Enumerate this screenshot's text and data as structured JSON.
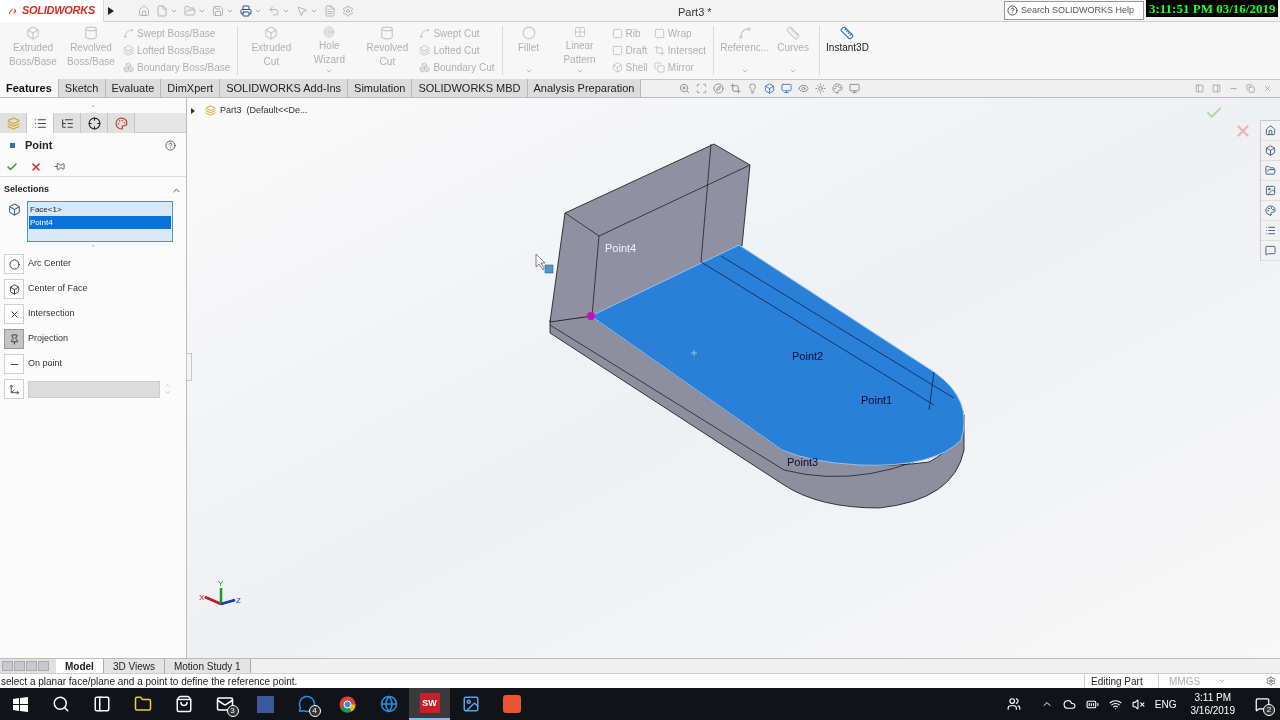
{
  "title_bar": {
    "logo": "SOLIDWORKS",
    "title": "Part3 *",
    "search": {
      "placeholder": "Search SOLIDWORKS Help"
    },
    "recording_timestamp": "3:11:51 PM 03/16/2019"
  },
  "ribbon": [
    {
      "kind": "large",
      "label": "Extruded Boss/Base",
      "disabled": true,
      "dropdown": false
    },
    {
      "kind": "large",
      "label": "Revolved Boss/Base",
      "disabled": true,
      "dropdown": false
    },
    {
      "kind": "stack",
      "items": [
        {
          "label": "Swept Boss/Base",
          "disabled": true
        },
        {
          "label": "Lofted Boss/Base",
          "disabled": true
        },
        {
          "label": "Boundary Boss/Base",
          "disabled": true
        }
      ]
    },
    {
      "kind": "separator"
    },
    {
      "kind": "large",
      "label": "Extruded Cut",
      "disabled": true,
      "dropdown": false
    },
    {
      "kind": "large",
      "label": "Hole Wizard",
      "disabled": true,
      "dropdown": true
    },
    {
      "kind": "large",
      "label": "Revolved Cut",
      "disabled": true,
      "dropdown": false
    },
    {
      "kind": "stack",
      "items": [
        {
          "label": "Swept Cut",
          "disabled": true
        },
        {
          "label": "Lofted Cut",
          "disabled": true
        },
        {
          "label": "Boundary Cut",
          "disabled": true
        }
      ]
    },
    {
      "kind": "separator"
    },
    {
      "kind": "large",
      "label": "Fillet",
      "disabled": true,
      "dropdown": true
    },
    {
      "kind": "large",
      "label": "Linear Pattern",
      "disabled": true,
      "dropdown": true
    },
    {
      "kind": "stack",
      "items": [
        {
          "label": "Rib",
          "disabled": true
        },
        {
          "label": "Draft",
          "disabled": true
        },
        {
          "label": "Shell",
          "disabled": true
        }
      ]
    },
    {
      "kind": "stack",
      "items": [
        {
          "label": "Wrap",
          "disabled": true
        },
        {
          "label": "Intersect",
          "disabled": true
        },
        {
          "label": "Mirror",
          "disabled": true
        }
      ]
    },
    {
      "kind": "separator"
    },
    {
      "kind": "large",
      "label": "Referenc...",
      "disabled": true,
      "dropdown": true
    },
    {
      "kind": "large",
      "label": "Curves",
      "disabled": true,
      "dropdown": true
    },
    {
      "kind": "separator"
    },
    {
      "kind": "large",
      "label": "Instant3D",
      "disabled": false,
      "dropdown": false
    }
  ],
  "tabs": [
    {
      "label": "Features",
      "selected": true
    },
    {
      "label": "Sketch",
      "selected": false
    },
    {
      "label": "Evaluate",
      "selected": false
    },
    {
      "label": "DimXpert",
      "selected": false
    },
    {
      "label": "SOLIDWORKS Add-Ins",
      "selected": false
    },
    {
      "label": "Simulation",
      "selected": false
    },
    {
      "label": "SOLIDWORKS MBD",
      "selected": false
    },
    {
      "label": "Analysis Preparation",
      "selected": false
    }
  ],
  "panel": {
    "tabs": [
      {
        "selected": false
      },
      {
        "selected": true
      },
      {
        "selected": false
      },
      {
        "selected": false
      },
      {
        "selected": false
      }
    ],
    "title": "Point",
    "selections": {
      "title": "Selections",
      "items": [
        {
          "label": "Face<1>",
          "selected": false
        },
        {
          "label": "Point4",
          "selected": true
        }
      ]
    },
    "options": [
      {
        "label": "Arc Center",
        "selected": false
      },
      {
        "label": "Center of Face",
        "selected": false
      },
      {
        "label": "Intersection",
        "selected": false
      },
      {
        "label": "Projection",
        "selected": true
      },
      {
        "label": "On point",
        "selected": false
      }
    ]
  },
  "viewport": {
    "breadcrumb": "Part3  (Default<<De...",
    "point_labels": [
      {
        "label": "Point4",
        "faded": true
      },
      {
        "label": "Point2",
        "faded": false
      },
      {
        "label": "Point1",
        "faded": false
      },
      {
        "label": "Point3",
        "faded": false
      }
    ],
    "axes": [
      "X",
      "Y",
      "Z"
    ]
  },
  "bottom_tabs": [
    {
      "label": "Model",
      "selected": true
    },
    {
      "label": "3D Views",
      "selected": false
    },
    {
      "label": "Motion Study 1",
      "selected": false
    }
  ],
  "status_bar": {
    "message": "select a planar face/plane and a point to define the reference point.",
    "mode": "Editing Part",
    "units": "MMGS"
  },
  "taskbar": {
    "mail_badge": "3",
    "messenger_badge": "4",
    "solidworks_icon": "SW",
    "language": "ENG",
    "time": "3:11 PM",
    "date": "3/16/2019",
    "notification_count": "2"
  }
}
